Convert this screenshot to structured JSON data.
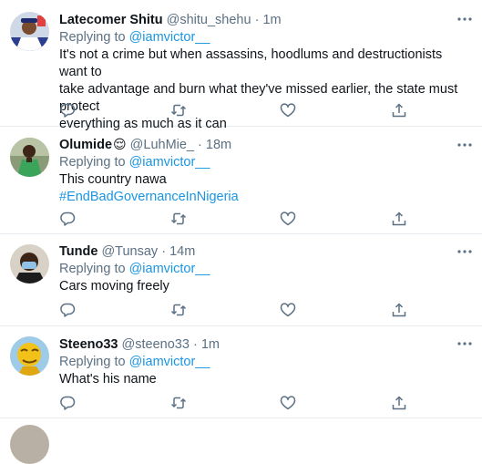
{
  "tweets": [
    {
      "name": "Latecomer Shitu",
      "handle": "@shitu_shehu",
      "dot": "·",
      "time": "1m",
      "reply_prefix": "Replying to",
      "reply_to": "@iamvictor__",
      "text_lines": [
        "It's not a crime but when assassins, hoodlums and destructionists want to",
        "take advantage and burn what they've missed earlier, the state must protect",
        "everything as much as it can"
      ]
    },
    {
      "name": "Olumide",
      "emoji": "😌",
      "handle": "@LuhMie_",
      "dot": "·",
      "time": "18m",
      "reply_prefix": "Replying to",
      "reply_to": "@iamvictor__",
      "text_lines": [
        "This country nawa"
      ],
      "hashtag": "#EndBadGovernanceInNigeria"
    },
    {
      "name": "Tunde",
      "handle": "@Tunsay",
      "dot": "·",
      "time": "14m",
      "reply_prefix": "Replying to",
      "reply_to": "@iamvictor__",
      "text_lines": [
        "Cars moving freely"
      ]
    },
    {
      "name": "Steeno33",
      "handle": "@steeno33",
      "dot": "·",
      "time": "1m",
      "reply_prefix": "Replying to",
      "reply_to": "@iamvictor__",
      "text_lines": [
        "What's his name"
      ]
    }
  ],
  "icons": {
    "more": "more-dots-icon",
    "reply": "reply-icon",
    "retweet": "retweet-icon",
    "like": "heart-icon",
    "share": "share-icon"
  },
  "colors": {
    "link": "#1b95e0",
    "secondary": "#5b7083",
    "divider": "#e6ecf0"
  }
}
